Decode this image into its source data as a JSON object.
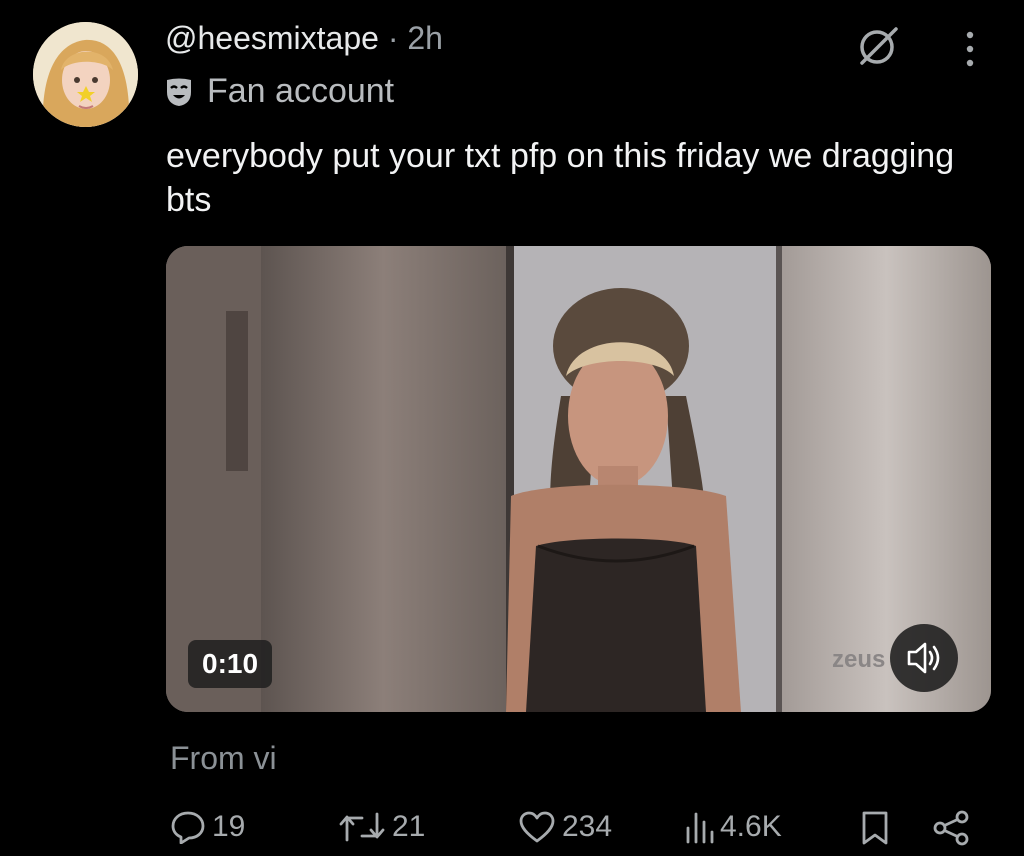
{
  "post": {
    "handle": "@heesmixtape",
    "time": "· 2h",
    "label": "Fan account",
    "text": "everybody put your txt pfp on this friday we dragging bts"
  },
  "media": {
    "duration": "0:10",
    "watermark": "zeus"
  },
  "from_text": "From vi",
  "actions": {
    "replies": "19",
    "reposts": "21",
    "likes": "234",
    "views": "4.6K"
  },
  "colors": {
    "background": "#000000",
    "text": "#e7e9ea",
    "secondary": "#8b9196"
  }
}
